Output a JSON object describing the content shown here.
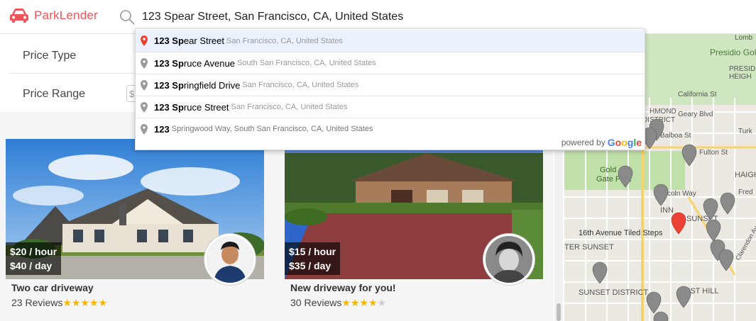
{
  "app": {
    "name": "ParkLender",
    "brand_color": "#f0535a"
  },
  "search": {
    "value": "123 Spear Street, San Francisco, CA, United States"
  },
  "filters": {
    "price_type_label": "Price Type",
    "price_range_label": "Price Range",
    "price_prefix": "$"
  },
  "autocomplete": {
    "items": [
      {
        "match": "123 Sp",
        "rest": "ear Street",
        "secondary": "San Francisco, CA, United States",
        "selected": true
      },
      {
        "match": "123 Sp",
        "rest": "ruce Avenue",
        "secondary": "South San Francisco, CA, United States",
        "selected": false
      },
      {
        "match": "123 Sp",
        "rest": "ringfield Drive",
        "secondary": "San Francisco, CA, United States",
        "selected": false
      },
      {
        "match": "123 Sp",
        "rest": "ruce Street",
        "secondary": "San Francisco, CA, United States",
        "selected": false
      },
      {
        "match": "123",
        "rest": "",
        "secondary": "Springwood Way, South San Francisco, CA, United States",
        "selected": false
      }
    ],
    "powered_by": "powered by",
    "google_letters": [
      "G",
      "o",
      "o",
      "g",
      "l",
      "e"
    ]
  },
  "listings": [
    {
      "hourly": "$20 / hour",
      "daily": "$40 / day",
      "title": "Two car driveway",
      "reviews": "23 Reviews",
      "stars_filled": "★★★★★",
      "stars_empty": ""
    },
    {
      "hourly": "$15 / hour",
      "daily": "$35 / day",
      "title": "New driveway for you!",
      "reviews": "30 Reviews",
      "stars_filled": "★★★★",
      "stars_empty": "★"
    }
  ],
  "map": {
    "labels": [
      "Lomb",
      "Presidio Golf",
      "PRESID",
      "HEIGH",
      "California St",
      "HMOND",
      "DISTRICT",
      "Geary Blvd",
      "Balboa St",
      "Turk",
      "Fulton St",
      "Gold",
      "Gate Park",
      "HAIGH",
      "coln Way",
      "Fred",
      "INN",
      "SUNSET",
      "16th Avenue Tiled Steps",
      "TER SUNSET",
      "Clarendon Av",
      "SUNSET DISTRICT",
      "EST HILL"
    ]
  }
}
